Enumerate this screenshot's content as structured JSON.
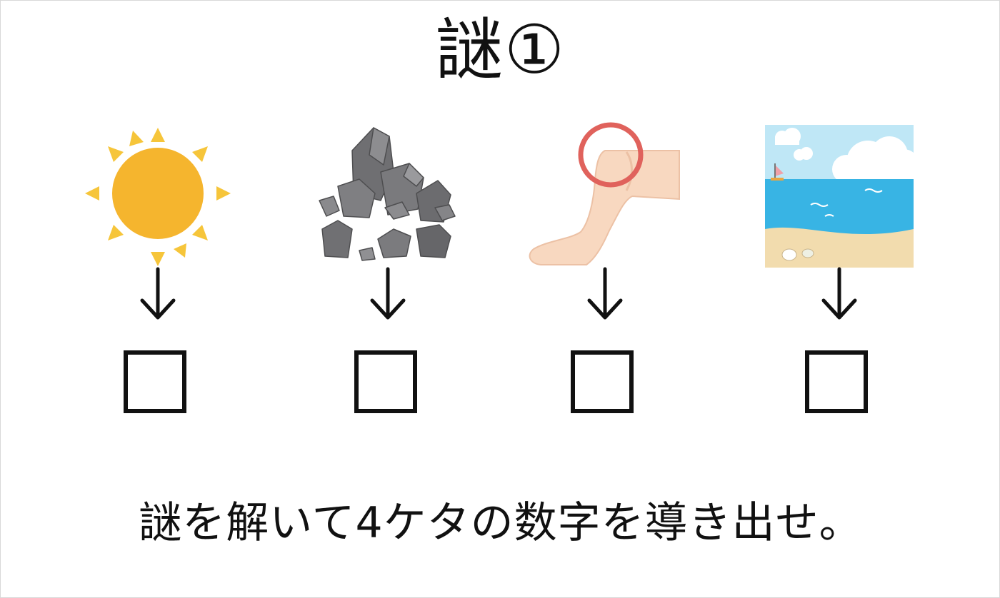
{
  "title": "謎①",
  "instruction": "謎を解いて4ケタの数字を導き出せ。",
  "clues": [
    {
      "picture": "sun-icon",
      "arrow": "↓",
      "answer": ""
    },
    {
      "picture": "rocks-icon",
      "arrow": "↓",
      "answer": ""
    },
    {
      "picture": "knee-icon",
      "arrow": "↓",
      "answer": ""
    },
    {
      "picture": "sea-icon",
      "arrow": "↓",
      "answer": ""
    }
  ],
  "colors": {
    "sun": "#f5b52e",
    "sun_rays": "#f6c53a",
    "rock": "#7c7c7f",
    "rock_dark": "#5a5a5c",
    "skin": "#f8d8c0",
    "circle": "#e0625c",
    "sea": "#38b4e4",
    "sky": "#bfe7f6",
    "sand": "#f2dcae"
  }
}
